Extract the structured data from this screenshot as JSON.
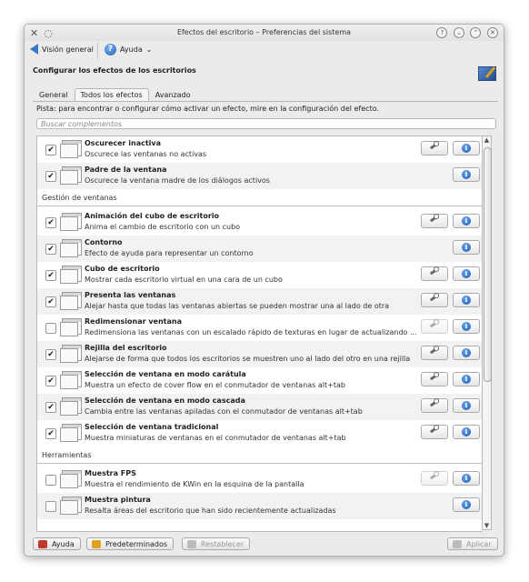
{
  "window": {
    "title": "Efectos del escritorio – Preferencias del sistema",
    "controls": [
      "help-icon",
      "minimize-icon",
      "maximize-icon",
      "close-icon"
    ]
  },
  "toolbar": {
    "overview_label": "Visión general",
    "help_label": "Ayuda"
  },
  "header": {
    "title": "Configurar los efectos de los escritorios"
  },
  "tabs": [
    {
      "label": "General"
    },
    {
      "label": "Todos los efectos"
    },
    {
      "label": "Avanzado"
    }
  ],
  "hint": "Pista: para encontrar o configurar cómo activar un efecto, mire en la configuración del efecto.",
  "search": {
    "placeholder": "Buscar complementos"
  },
  "categories": {
    "window_mgmt": "Gestión de ventanas",
    "tools": "Herramientas"
  },
  "effects": [
    {
      "title": "Oscurecer inactiva",
      "desc": "Oscurece las ventanas no activas",
      "checked": true,
      "configurable": true
    },
    {
      "title": "Padre de la ventana",
      "desc": "Oscurece la ventana madre de los diálogos activos",
      "checked": true,
      "configurable": false
    },
    {
      "title": "Animación del cubo de escritorio",
      "desc": "Anima el cambio de escritorio con un cubo",
      "checked": true,
      "configurable": true
    },
    {
      "title": "Contorno",
      "desc": "Efecto de ayuda para representar un contorno",
      "checked": true,
      "configurable": false
    },
    {
      "title": "Cubo de escritorio",
      "desc": "Mostrar cada escritorio virtual en una cara de un cubo",
      "checked": true,
      "configurable": true
    },
    {
      "title": "Presenta las ventanas",
      "desc": "Alejar hasta que todas las ventanas abiertas se pueden mostrar una al lado de otra",
      "checked": true,
      "configurable": true
    },
    {
      "title": "Redimensionar ventana",
      "desc": "Redimensiona las ventanas con un escalado rápido de texturas en lugar de actualizando ...",
      "checked": false,
      "configurable": "disabled"
    },
    {
      "title": "Rejilla del escritorio",
      "desc": "Alejarse de forma que todos los escritorios se muestren uno al lado del otro en una rejilla",
      "checked": true,
      "configurable": true
    },
    {
      "title": "Selección de ventana en modo carátula",
      "desc": "Muestra un efecto de cover flow en el conmutador de ventanas alt+tab",
      "checked": true,
      "configurable": true
    },
    {
      "title": "Selección de ventana en modo cascada",
      "desc": "Cambia entre las ventanas apiladas con el conmutador de ventanas alt+tab",
      "checked": true,
      "configurable": true
    },
    {
      "title": "Selección de ventana tradicional",
      "desc": "Muestra miniaturas de ventanas en el conmutador de ventanas alt+tab",
      "checked": true,
      "configurable": true
    },
    {
      "title": "Muestra FPS",
      "desc": "Muestra el rendimiento de KWin en la esquina de la pantalla",
      "checked": false,
      "configurable": "disabled"
    },
    {
      "title": "Muestra pintura",
      "desc": "Resalta áreas del escritorio que han sido recientemente actualizadas",
      "checked": false,
      "configurable": false
    }
  ],
  "buttons": {
    "help": "Ayuda",
    "defaults": "Predeterminados",
    "reset": "Restablecer",
    "apply": "Aplicar"
  }
}
